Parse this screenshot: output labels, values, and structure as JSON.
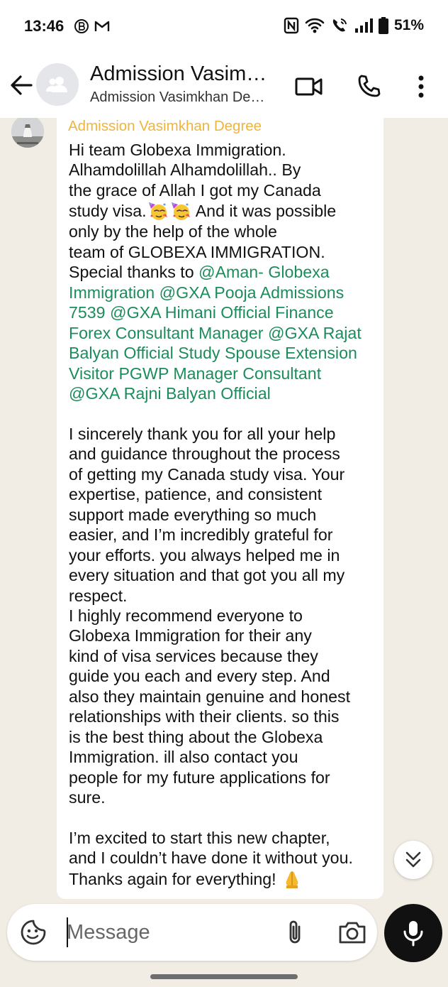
{
  "status_bar": {
    "time": "13:46",
    "battery_percent": "51%"
  },
  "header": {
    "title": "Admission Vasim…",
    "subtitle": "Admission Vasimkhan De…"
  },
  "message": {
    "sender": "Admission Vasimkhan Degree",
    "paragraph1": [
      [
        {
          "t": "Hi team Globexa Immigration."
        }
      ],
      [
        {
          "t": "Alhamdolillah Alhamdolillah.. By"
        }
      ],
      [
        {
          "t": "the grace of Allah I got my Canada"
        }
      ],
      [
        {
          "t": "study visa."
        },
        {
          "emoji": "partying-face"
        },
        {
          "emoji": "partying-face"
        },
        {
          "t": " And it was possible"
        }
      ],
      [
        {
          "t": "only by the help of the whole"
        }
      ],
      [
        {
          "t": "team of GLOBEXA IMMIGRATION."
        }
      ],
      [
        {
          "t": "Special thanks to "
        },
        {
          "m": "@Aman- Globexa"
        }
      ],
      [
        {
          "m": "Immigration @GXA Pooja Admissions"
        }
      ],
      [
        {
          "m": "7539 @GXA Himani Official Finance"
        }
      ],
      [
        {
          "m": "Forex Consultant Manager @GXA Rajat"
        }
      ],
      [
        {
          "m": "Balyan Official Study Spouse Extension"
        }
      ],
      [
        {
          "m": "Visitor PGWP Manager Consultant"
        }
      ],
      [
        {
          "m": "@GXA Rajni Balyan Official"
        }
      ]
    ],
    "paragraph2": [
      "I  sincerely thank you for all your help",
      "and guidance throughout the process",
      "of getting my Canada study visa. Your",
      "expertise, patience, and consistent",
      "support made everything so much",
      "easier, and I’m incredibly grateful for",
      "your efforts. you always helped me in",
      "every situation and that got you all my",
      "respect.",
      "I highly recommend everyone to",
      "Globexa Immigration  for their any",
      "kind of visa services because they",
      "guide you each and every step. And",
      "also they maintain genuine and honest",
      "relationships with their clients. so this",
      "is the best thing about the Globexa",
      "Immigration. ill also contact you",
      "people for my future applications for",
      "sure."
    ],
    "paragraph3": [
      [
        {
          "t": "I’m excited to start this new chapter,"
        }
      ],
      [
        {
          "t": "and I couldn’t have done it without you."
        }
      ],
      [
        {
          "t": "Thanks again for everything! "
        },
        {
          "emoji": "folded-hands"
        }
      ]
    ]
  },
  "composer": {
    "placeholder": "Message"
  },
  "colors": {
    "sender_name": "#f0b43c",
    "mention": "#1c8c5c",
    "chat_background": "#f1ede4",
    "mic_button": "#111111"
  },
  "icons": [
    "back-arrow-icon",
    "contact-avatar-icon",
    "video-call-icon",
    "phone-icon",
    "more-vertical-icon",
    "scroll-down-icon",
    "sticker-icon",
    "attachment-icon",
    "camera-icon",
    "microphone-icon",
    "partying-face-emoji",
    "folded-hands-emoji"
  ]
}
